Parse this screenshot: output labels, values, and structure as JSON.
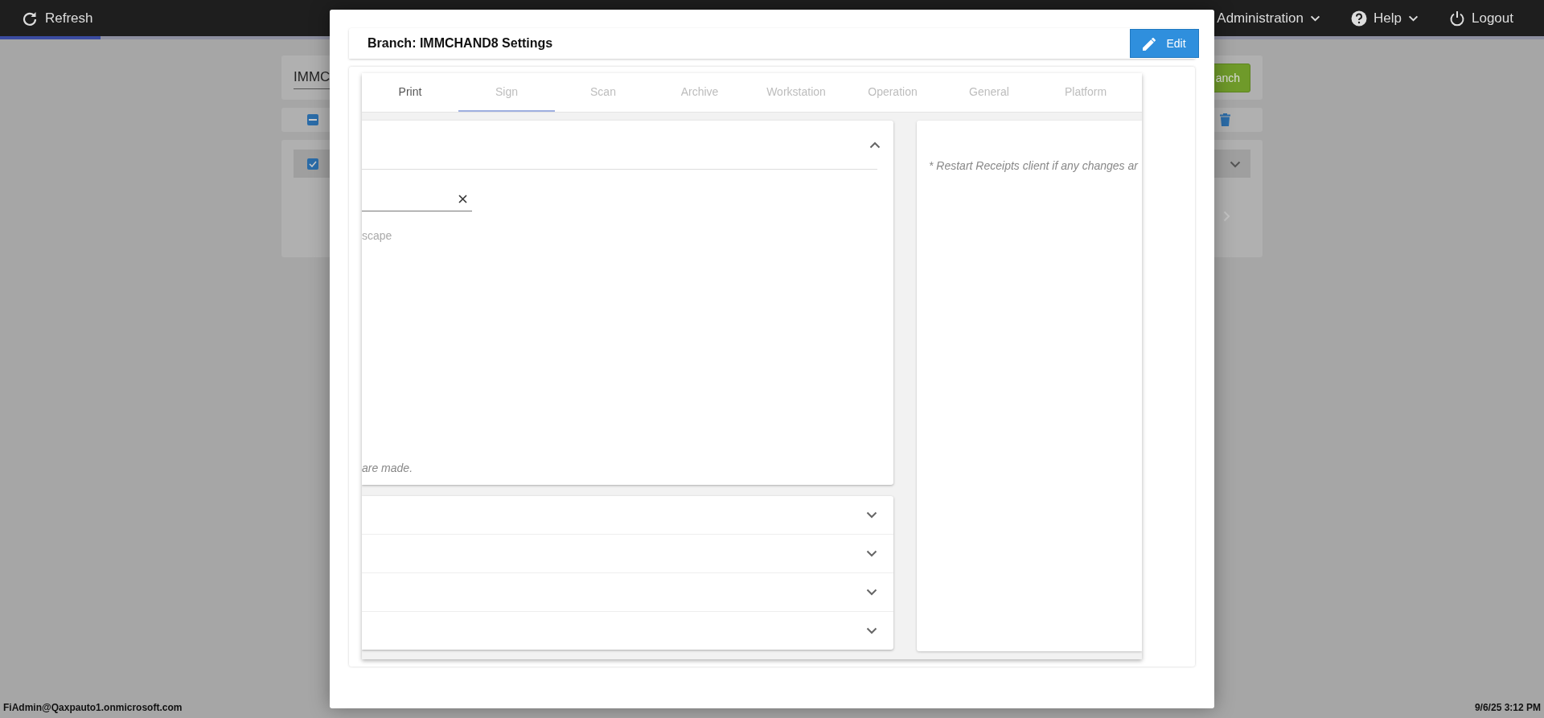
{
  "top_bar": {
    "refresh_label": "Refresh",
    "progress": {
      "level": 0.065
    },
    "menus": [
      {
        "label": "Administration",
        "kind": "menu"
      },
      {
        "label": "Help",
        "kind": "help"
      },
      {
        "label": "Logout",
        "kind": "logout"
      }
    ]
  },
  "background": {
    "search_value": "IMMC",
    "add_button": "anch",
    "select_all_indeterminate": true,
    "branch_row_checked": true
  },
  "dialog": {
    "title": "Branch: IMMCHAND8 Settings",
    "edit_button": "Edit",
    "tabs": [
      {
        "label": "Print",
        "selected": false,
        "disabled": false
      },
      {
        "label": "Sign",
        "selected": true,
        "disabled": true
      },
      {
        "label": "Scan",
        "selected": false,
        "disabled": true
      },
      {
        "label": "Archive",
        "selected": false,
        "disabled": true
      },
      {
        "label": "Workstation",
        "selected": false,
        "disabled": true
      },
      {
        "label": "Operation",
        "selected": false,
        "disabled": true
      },
      {
        "label": "General",
        "selected": false,
        "disabled": true
      },
      {
        "label": "Platform",
        "selected": false,
        "disabled": true
      }
    ],
    "section": {
      "expanded": true,
      "option_text": "scape",
      "note": "are made."
    },
    "collapsed_sections": [
      {
        "expanded": false
      },
      {
        "expanded": false
      },
      {
        "expanded": false
      },
      {
        "expanded": false
      }
    ],
    "side_note": "* Restart Receipts client if any changes ar"
  },
  "status_bar": {
    "user": "FiAdmin@Qaxpauto1.onmicrosoft.com",
    "datetime": "9/6/25 3:12 PM"
  }
}
